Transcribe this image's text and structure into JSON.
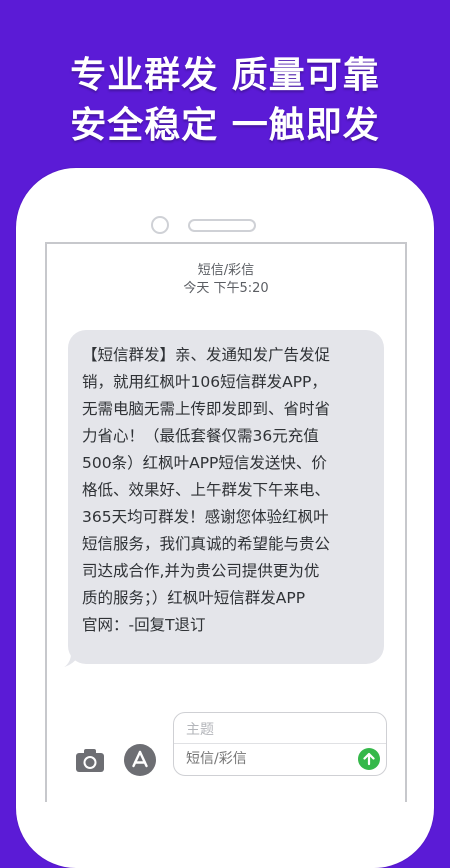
{
  "promo": {
    "line1": "专业群发  质量可靠",
    "line2": "安全稳定  一触即发"
  },
  "sms": {
    "header_label": "短信/彩信",
    "timestamp": "今天 下午5:20",
    "message_lines": [
      "【短信群发】亲、发通知发广告发促",
      "销，就用红枫叶106短信群发APP，",
      "无需电脑无需上传即发即到、省时省",
      "力省心！（最低套餐仅需36元充值",
      "500条）红枫叶APP短信发送快、价",
      "格低、效果好、上午群发下午来电、",
      "365天均可群发！感谢您体验红枫叶",
      "短信服务，我们真诚的希望能与贵公",
      "司达成合作,并为贵公司提供更为优",
      "质的服务；）红枫叶短信群发APP",
      "官网：-回复T退订"
    ]
  },
  "composer": {
    "subject_placeholder": "主题",
    "message_placeholder": "短信/彩信",
    "camera_icon": "camera-icon",
    "appstore_icon": "app-store-icon",
    "send_icon": "send-arrow-icon"
  },
  "colors": {
    "background": "#5b1bd6",
    "bubble": "#e4e5ea",
    "send": "#35b84a"
  }
}
